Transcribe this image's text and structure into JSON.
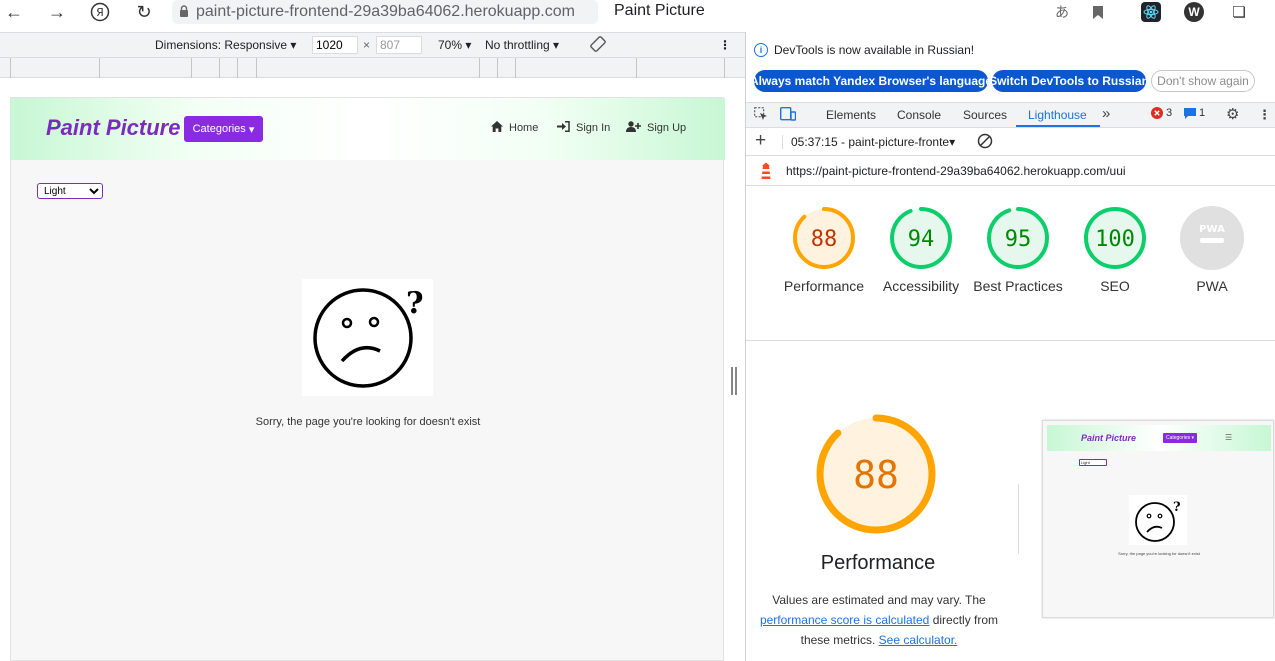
{
  "browser": {
    "url": "paint-picture-frontend-29a39ba64062.herokuapp.com",
    "title": "Paint Picture",
    "icons": [
      "back-icon",
      "forward-icon",
      "yandex-icon",
      "reload-icon",
      "lock-icon",
      "translate-icon",
      "bookmark-icon",
      "react-devtools-icon",
      "w-extension-icon",
      "extensions-icon"
    ]
  },
  "device_toolbar": {
    "dimensions_label": "Dimensions: Responsive",
    "width": "1020",
    "times": "×",
    "height": "807",
    "zoom": "70%",
    "throttling": "No throttling"
  },
  "site": {
    "brand": "Paint Picture",
    "categories_label": "Categories",
    "nav": {
      "home": "Home",
      "sign_in": "Sign In",
      "sign_up": "Sign Up"
    },
    "theme_selected": "Light",
    "not_found_text": "Sorry, the page you're looking for doesn't exist"
  },
  "devtools": {
    "infobar": {
      "message": "DevTools is now available in Russian!",
      "btn_match": "Always match Yandex Browser's language",
      "btn_switch": "Switch DevTools to Russian",
      "btn_dismiss": "Don't show again"
    },
    "tabs": [
      "Elements",
      "Console",
      "Sources",
      "Lighthouse"
    ],
    "active_tab": "Lighthouse",
    "error_count": "3",
    "message_count": "1",
    "report_selector": "05:37:15 - paint-picture-fronte",
    "report_url": "https://paint-picture-frontend-29a39ba64062.herokuapp.com/uui",
    "scores": [
      {
        "label": "Performance",
        "value": "88",
        "color": "#ffa400"
      },
      {
        "label": "Accessibility",
        "value": "94",
        "color": "#0cce6b"
      },
      {
        "label": "Best Practices",
        "value": "95",
        "color": "#0cce6b"
      },
      {
        "label": "SEO",
        "value": "100",
        "color": "#0cce6b"
      },
      {
        "label": "PWA",
        "value": "PWA",
        "color": "#9aa0a6"
      }
    ],
    "detail": {
      "score": "88",
      "title": "Performance",
      "desc_1": "Values are estimated and may vary. The",
      "link_1": "performance score is calculated",
      "desc_2": "directly from these metrics.",
      "link_2": "See calculator."
    },
    "thumbnail": {
      "brand": "Paint Picture",
      "categories": "Categories ▾",
      "theme": "Light",
      "sorry": "Sorry, the page you're looking for doesn't exist"
    }
  },
  "colors": {
    "brand_purple": "#7b2cbf",
    "button_purple": "#8a2be2",
    "lighthouse_orange": "#ffa400",
    "lighthouse_green": "#0cce6b",
    "devtools_blue": "#1a73e8"
  }
}
